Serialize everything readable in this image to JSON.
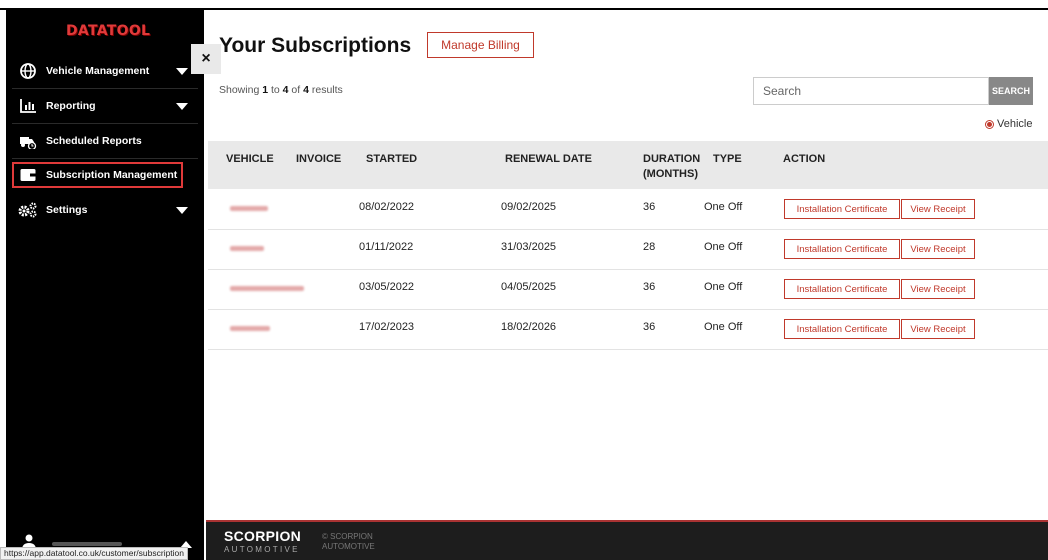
{
  "sidebar": {
    "logo": "DATATOOL",
    "items": [
      {
        "label": "Vehicle Management",
        "icon": "globe-icon"
      },
      {
        "label": "Reporting",
        "icon": "bar-chart-icon"
      },
      {
        "label": "Scheduled Reports",
        "icon": "truck-clock-icon"
      },
      {
        "label": "Subscription Management",
        "icon": "wallet-icon"
      },
      {
        "label": "Settings",
        "icon": "gears-icon"
      }
    ],
    "active_item": "Subscription Management",
    "close_label": "×"
  },
  "status_url": "https://app.datatool.co.uk/customer/subscription",
  "main": {
    "title": "Your Subscriptions",
    "manage_billing": "Manage Billing",
    "showing": {
      "prefix": "Showing",
      "from": "1",
      "to_word": "to",
      "to": "4",
      "of_word": "of",
      "total": "4",
      "suffix": "results"
    },
    "search": {
      "placeholder": "Search",
      "button": "SEARCH"
    },
    "filter_radio": "Vehicle"
  },
  "table": {
    "columns": [
      "VEHICLE",
      "INVOICE",
      "STARTED",
      "RENEWAL DATE",
      "DURATION (MONTHS)",
      "TYPE",
      "ACTION"
    ],
    "duration_header": {
      "line1": "DURATION",
      "line2": "(MONTHS)"
    },
    "rows": [
      {
        "started": "08/02/2022",
        "renewal": "09/02/2025",
        "duration": "36",
        "type": "One Off",
        "action1": "Installation Certificate",
        "action2": "View Receipt"
      },
      {
        "started": "01/11/2022",
        "renewal": "31/03/2025",
        "duration": "28",
        "type": "One Off",
        "action1": "Installation Certificate",
        "action2": "View Receipt"
      },
      {
        "started": "03/05/2022",
        "renewal": "04/05/2025",
        "duration": "36",
        "type": "One Off",
        "action1": "Installation Certificate",
        "action2": "View Receipt"
      },
      {
        "started": "17/02/2023",
        "renewal": "18/02/2026",
        "duration": "36",
        "type": "One Off",
        "action1": "Installation Certificate",
        "action2": "View Receipt"
      }
    ]
  },
  "footer": {
    "brand": "SCORPION",
    "brand_sub": "AUTOMOTIVE",
    "copyright_line1": "© SCORPION",
    "copyright_line2": "AUTOMOTIVE"
  },
  "colors": {
    "accent": "#c0392b",
    "sidebar_bg": "#000000",
    "header_bg": "#e9e9e9",
    "footer_bg": "#1d1d1d"
  }
}
